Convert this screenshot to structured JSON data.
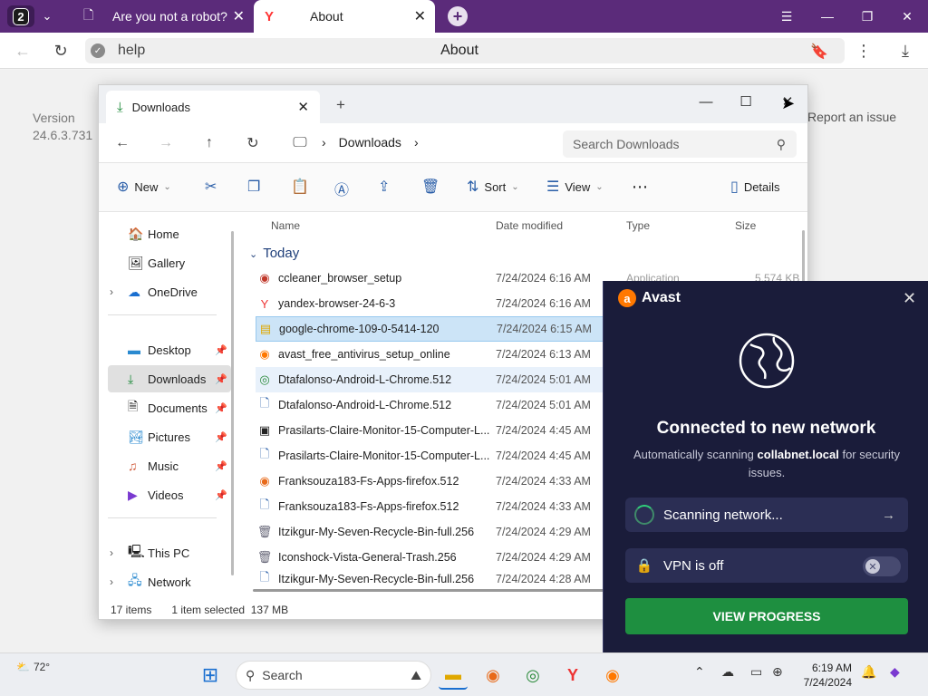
{
  "browser": {
    "tab_count": "2",
    "tabs": [
      {
        "label": "Are you not a robot?"
      },
      {
        "label": "About"
      }
    ],
    "address": {
      "url": "help",
      "page_title": "About"
    }
  },
  "page": {
    "version_label": "Version",
    "version_number": "24.6.3.731",
    "report_link": "Report an issue"
  },
  "explorer": {
    "tab_title": "Downloads",
    "breadcrumb": "Downloads",
    "search_placeholder": "Search Downloads",
    "toolbar": {
      "new": "New",
      "sort": "Sort",
      "view": "View",
      "details": "Details"
    },
    "sidebar": {
      "home": "Home",
      "gallery": "Gallery",
      "onedrive": "OneDrive",
      "desktop": "Desktop",
      "downloads": "Downloads",
      "documents": "Documents",
      "pictures": "Pictures",
      "music": "Music",
      "videos": "Videos",
      "thispc": "This PC",
      "network": "Network"
    },
    "columns": {
      "name": "Name",
      "date": "Date modified",
      "type": "Type",
      "size": "Size"
    },
    "group": "Today",
    "files": [
      {
        "name": "ccleaner_browser_setup",
        "date": "7/24/2024 6:16 AM",
        "type": "Application",
        "size": "5,574 KB"
      },
      {
        "name": "yandex-browser-24-6-3",
        "date": "7/24/2024 6:16 AM"
      },
      {
        "name": "google-chrome-109-0-5414-120",
        "date": "7/24/2024 6:15 AM"
      },
      {
        "name": "avast_free_antivirus_setup_online",
        "date": "7/24/2024 6:13 AM"
      },
      {
        "name": "Dtafalonso-Android-L-Chrome.512",
        "date": "7/24/2024 5:01 AM"
      },
      {
        "name": "Dtafalonso-Android-L-Chrome.512",
        "date": "7/24/2024 5:01 AM"
      },
      {
        "name": "Prasilarts-Claire-Monitor-15-Computer-L...",
        "date": "7/24/2024 4:45 AM"
      },
      {
        "name": "Prasilarts-Claire-Monitor-15-Computer-L...",
        "date": "7/24/2024 4:45 AM"
      },
      {
        "name": "Franksouza183-Fs-Apps-firefox.512",
        "date": "7/24/2024 4:33 AM"
      },
      {
        "name": "Franksouza183-Fs-Apps-firefox.512",
        "date": "7/24/2024 4:33 AM"
      },
      {
        "name": "Itzikgur-My-Seven-Recycle-Bin-full.256",
        "date": "7/24/2024 4:29 AM"
      },
      {
        "name": "Iconshock-Vista-General-Trash.256",
        "date": "7/24/2024 4:29 AM"
      },
      {
        "name": "Itzikgur-My-Seven-Recycle-Bin-full.256",
        "date": "7/24/2024 4:28 AM"
      }
    ],
    "status": {
      "items": "17 items",
      "selected": "1 item selected",
      "size": "137 MB"
    }
  },
  "avast": {
    "brand": "Avast",
    "heading": "Connected to new network",
    "desc_pre": "Automatically scanning ",
    "desc_bold": "collabnet.local",
    "desc_post": " for security issues.",
    "scan_label": "Scanning network...",
    "vpn_label": "VPN is off",
    "button": "VIEW PROGRESS"
  },
  "taskbar": {
    "temperature": "72°",
    "search": "Search",
    "time": "6:19 AM",
    "date": "7/24/2024"
  },
  "colors": {
    "browser_chrome": "#5b2b7a",
    "avast_bg": "#1a1c3a",
    "avast_button": "#1e8f40",
    "selection": "#cce4f7"
  }
}
